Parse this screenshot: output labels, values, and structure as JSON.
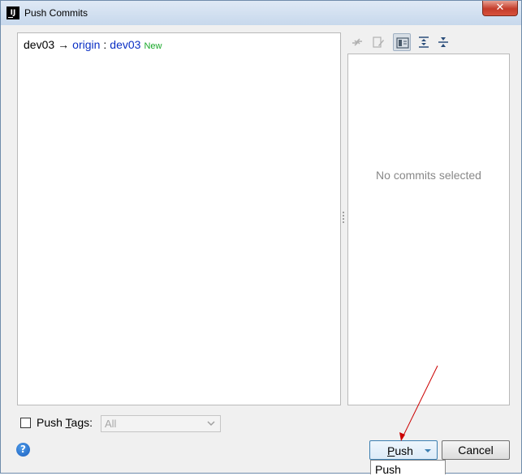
{
  "window": {
    "title": "Push Commits",
    "app_icon": "intellij-icon",
    "close_glyph": "✕"
  },
  "repo": {
    "local_branch": "dev03",
    "arrow": "→",
    "remote": "origin",
    "separator": ":",
    "remote_branch": "dev03",
    "badge": "New",
    "badge_color": "#17a828",
    "link_color": "#0a2fc4"
  },
  "toolbar": {
    "icons": [
      "merge-icon",
      "edit-icon",
      "group-by-icon",
      "expand-all-icon",
      "collapse-all-icon"
    ]
  },
  "details": {
    "empty_text": "No commits selected"
  },
  "tags": {
    "checkbox_checked": false,
    "label_prefix": "Push ",
    "label_mnemonic": "T",
    "label_rest": "ags:",
    "select_value": "All"
  },
  "help": {
    "glyph": "?"
  },
  "buttons": {
    "push_mnemonic": "P",
    "push_rest": "ush",
    "cancel": "Cancel"
  },
  "dropdown": {
    "items": [
      "Push"
    ]
  },
  "colors": {
    "accent": "#3c7fb1",
    "annotation_arrow": "#cc0000"
  }
}
